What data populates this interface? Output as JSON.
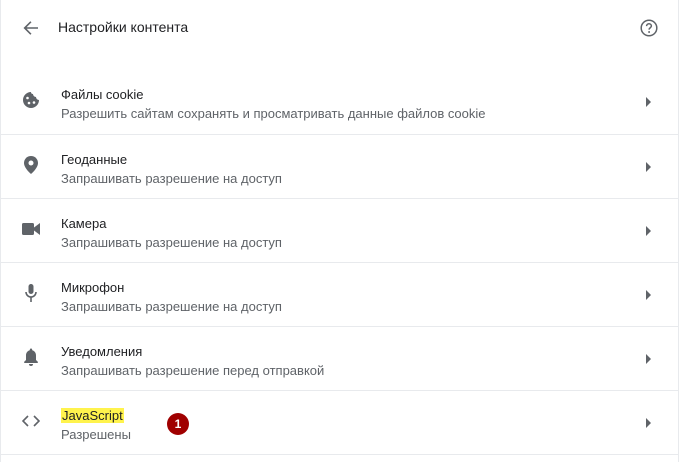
{
  "header": {
    "title": "Настройки контента",
    "back_icon": "arrow-back-icon",
    "help_icon": "help-circle-icon"
  },
  "items": [
    {
      "title": "Файлы cookie",
      "subtitle": "Разрешить сайтам сохранять и просматривать данные файлов cookie",
      "icon": "cookie-icon"
    },
    {
      "title": "Геоданные",
      "subtitle": "Запрашивать разрешение на доступ",
      "icon": "location-pin-icon"
    },
    {
      "title": "Камера",
      "subtitle": "Запрашивать разрешение на доступ",
      "icon": "camera-icon"
    },
    {
      "title": "Микрофон",
      "subtitle": "Запрашивать разрешение на доступ",
      "icon": "microphone-icon"
    },
    {
      "title": "Уведомления",
      "subtitle": "Запрашивать разрешение перед отправкой",
      "icon": "bell-icon"
    },
    {
      "title": "JavaScript",
      "subtitle": "Разрешены",
      "icon": "code-brackets-icon",
      "badge": "1"
    }
  ],
  "colors": {
    "highlight": "#fff34d",
    "badge": "#a00000",
    "icon": "#5f6368",
    "divider": "#e8eaed"
  }
}
